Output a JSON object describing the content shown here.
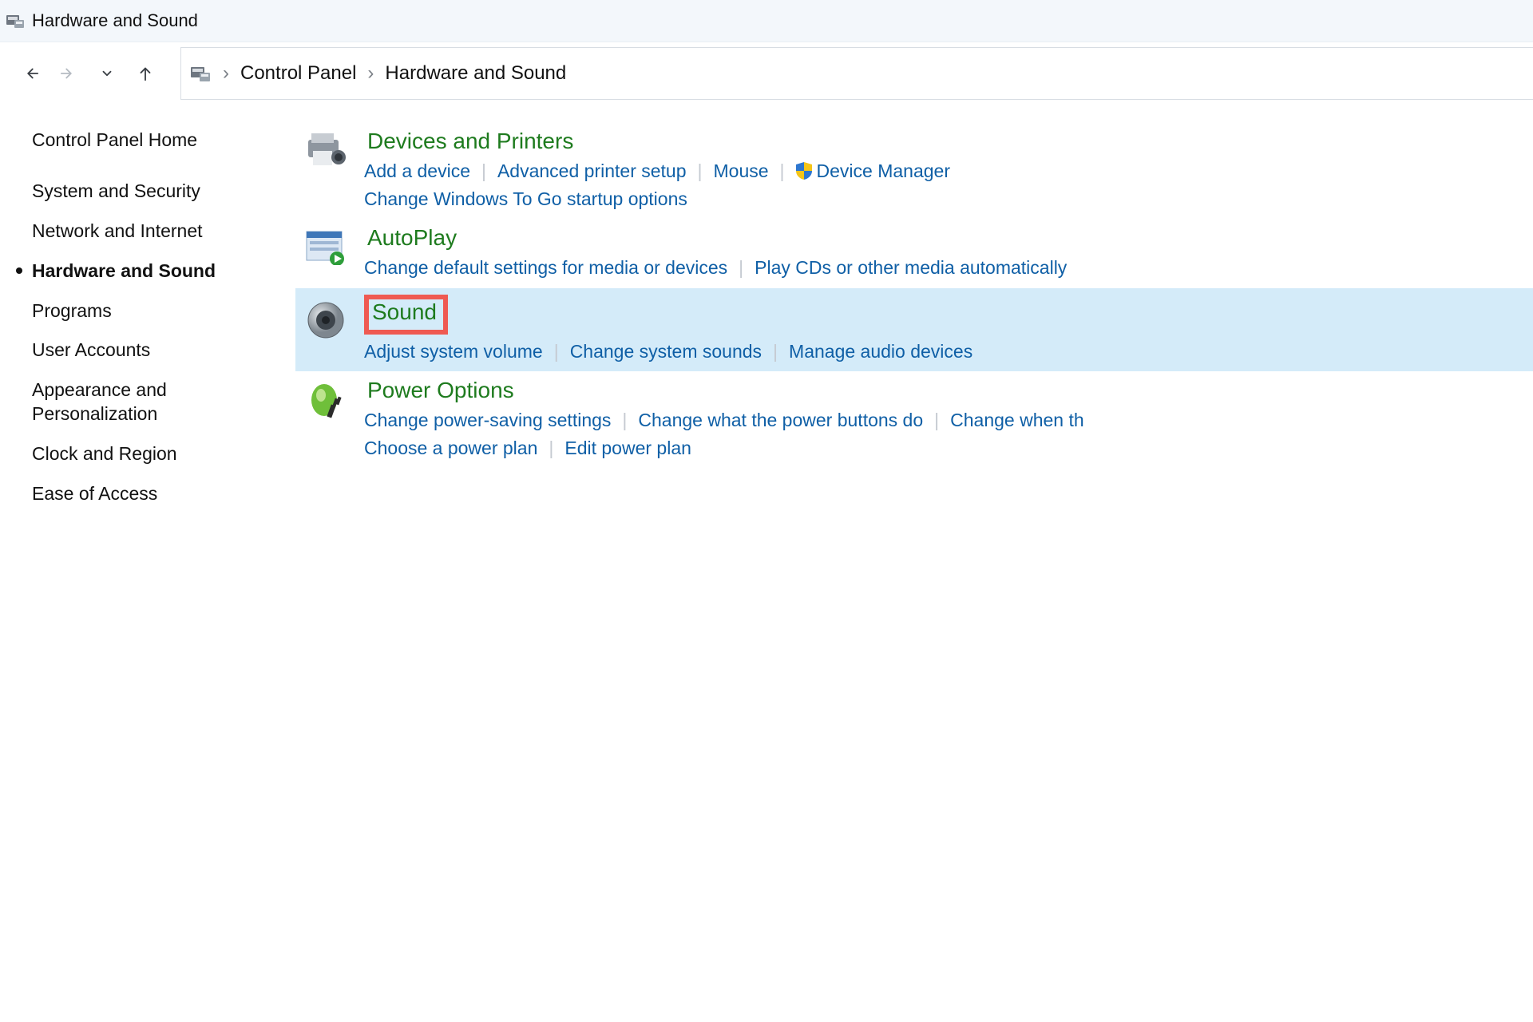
{
  "window": {
    "title": "Hardware and Sound"
  },
  "breadcrumbs": [
    "Control Panel",
    "Hardware and Sound"
  ],
  "sidebar": {
    "home": "Control Panel Home",
    "items": [
      "System and Security",
      "Network and Internet",
      "Hardware and Sound",
      "Programs",
      "User Accounts",
      "Appearance and Personalization",
      "Clock and Region",
      "Ease of Access"
    ],
    "current_index": 2
  },
  "categories": [
    {
      "title": "Devices and Printers",
      "icon": "printer-icon",
      "links": [
        {
          "label": "Add a device"
        },
        {
          "label": "Advanced printer setup"
        },
        {
          "label": "Mouse"
        },
        {
          "label": "Device Manager",
          "shield": true
        },
        {
          "label": "Change Windows To Go startup options",
          "break_before": true
        }
      ]
    },
    {
      "title": "AutoPlay",
      "icon": "autoplay-icon",
      "links": [
        {
          "label": "Change default settings for media or devices"
        },
        {
          "label": "Play CDs or other media automatically"
        }
      ]
    },
    {
      "title": "Sound",
      "icon": "speaker-icon",
      "highlight": true,
      "boxed": true,
      "links": [
        {
          "label": "Adjust system volume"
        },
        {
          "label": "Change system sounds"
        },
        {
          "label": "Manage audio devices"
        }
      ]
    },
    {
      "title": "Power Options",
      "icon": "power-icon",
      "links": [
        {
          "label": "Change power-saving settings"
        },
        {
          "label": "Change what the power buttons do"
        },
        {
          "label": "Change when th"
        },
        {
          "label": "Choose a power plan",
          "break_before": true
        },
        {
          "label": "Edit power plan"
        }
      ]
    }
  ]
}
